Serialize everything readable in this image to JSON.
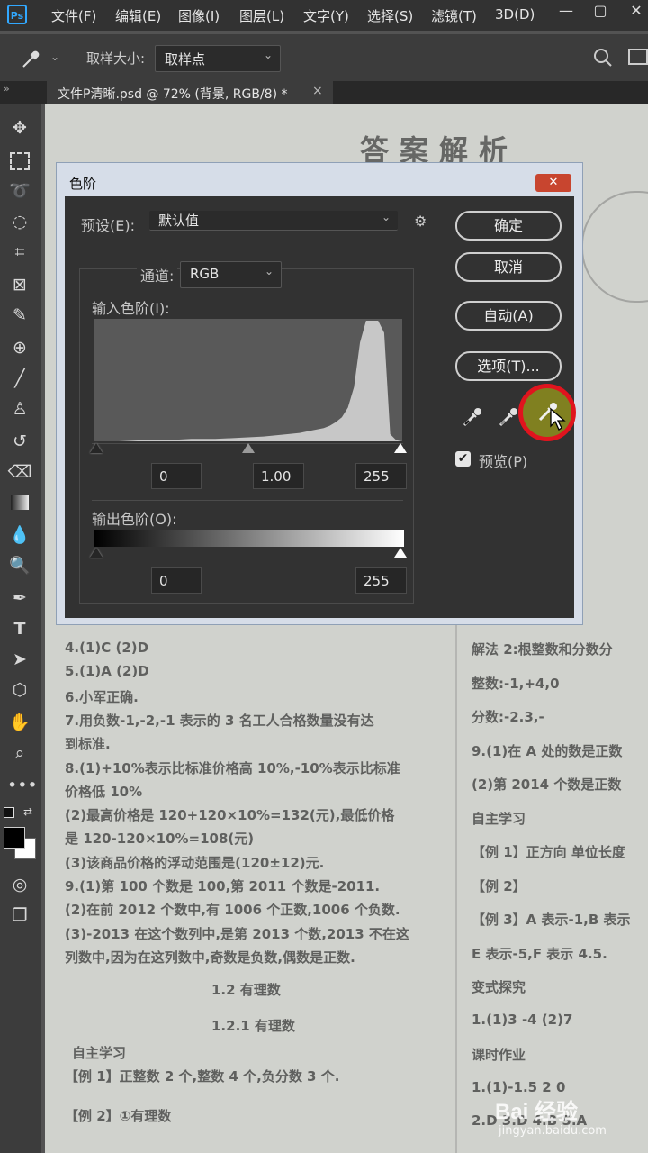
{
  "app": {
    "logo": "Ps"
  },
  "menu": [
    "文件(F)",
    "编辑(E)",
    "图像(I)",
    "图层(L)",
    "文字(Y)",
    "选择(S)",
    "滤镜(T)",
    "3D(D)"
  ],
  "options_bar": {
    "sample_size_label": "取样大小:",
    "sample_size_value": "取样点"
  },
  "document_tab": {
    "title": "文件P清晰.psd @ 72% (背景, RGB/8) *",
    "close": "×"
  },
  "dialog": {
    "title": "色阶",
    "close": "✕",
    "preset_label": "预设(E):",
    "preset_value": "默认值",
    "channel_label": "通道:",
    "channel_value": "RGB",
    "input_levels_label": "输入色阶(I):",
    "input_black": "0",
    "input_gamma": "1.00",
    "input_white": "255",
    "output_levels_label": "输出色阶(O):",
    "output_black": "0",
    "output_white": "255",
    "buttons": {
      "ok": "确定",
      "cancel": "取消",
      "auto": "自动(A)",
      "options": "选项(T)..."
    },
    "preview_label": "预览(P)",
    "preview_checked": true
  },
  "document_text": {
    "heading": "答案解析",
    "lines_left": [
      "4.(1)C   (2)D",
      "5.(1)A   (2)D",
      "6.小军正确.",
      "7.用负数-1,-2,-1 表示的 3 名工人合格数量没有达",
      "到标准.",
      "8.(1)+10%表示比标准价格高 10%,-10%表示比标准",
      "价格低 10%",
      "(2)最高价格是 120+120×10%=132(元),最低价格",
      "是 120-120×10%=108(元)",
      "(3)该商品价格的浮动范围是(120±12)元.",
      "9.(1)第 100 个数是 100,第 2011 个数是-2011.",
      "(2)在前 2012 个数中,有 1006 个正数,1006 个负数.",
      "(3)-2013 在这个数列中,是第 2013 个数,2013 不在这",
      "列数中,因为在这列数中,奇数是负数,偶数是正数."
    ],
    "section_title": "1.2  有理数",
    "subsection_title": "1.2.1  有理数",
    "self_study": "自主学习",
    "example1": "【例 1】正整数 2 个,整数 4 个,负分数 3 个.",
    "example2": "【例 2】①有理数",
    "lines_right": [
      "解法 2:根整数和分数分",
      "整数:-1,+4,0",
      "分数:-2.3,-",
      "9.(1)在 A 处的数是正数",
      "(2)第 2014 个数是正数",
      "自主学习",
      "【例 1】正方向  单位长度",
      "【例 2】",
      "【例 3】A 表示-1,B 表示",
      "E 表示-5,F 表示 4.5.",
      "变式探究",
      "1.(1)3   -4  (2)7",
      "课时作业",
      "1.(1)-1.5  2  0",
      "2.D  3.D  4.B  5.A"
    ]
  },
  "watermark": {
    "brand": "Bai 经验",
    "url": "jingyan.baidu.com"
  },
  "chart_data": {
    "type": "area",
    "title": "",
    "x": [
      0,
      20,
      40,
      60,
      80,
      100,
      120,
      140,
      160,
      170,
      180,
      190,
      195,
      200,
      205,
      210,
      215,
      220,
      225,
      230,
      235,
      240,
      245,
      250,
      255
    ],
    "values": [
      0,
      0,
      1,
      1,
      2,
      2,
      3,
      4,
      6,
      7,
      9,
      11,
      13,
      16,
      20,
      28,
      45,
      82,
      100,
      100,
      100,
      90,
      6,
      1,
      0
    ],
    "xlim": [
      0,
      255
    ],
    "ylim": [
      0,
      100
    ]
  }
}
